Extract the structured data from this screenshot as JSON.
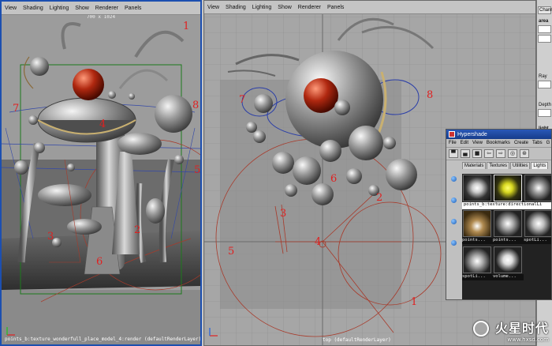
{
  "left_viewport": {
    "menu": [
      "View",
      "Shading",
      "Lighting",
      "Show",
      "Renderer",
      "Panels"
    ],
    "resolution": "700 x 1024",
    "caption": "points_b:texture_wonderfull_place_model_4:render (defaultRenderLayer)",
    "numbers": [
      "1",
      "2",
      "3",
      "4",
      "5",
      "6",
      "7",
      "8"
    ]
  },
  "right_viewport": {
    "menu": [
      "View",
      "Shading",
      "Lighting",
      "Show",
      "Renderer",
      "Panels"
    ],
    "caption": "top (defaultRenderLayer)",
    "numbers": [
      "1",
      "2",
      "3",
      "4",
      "5",
      "6",
      "7",
      "8"
    ]
  },
  "side_panel": {
    "tab": "Chann",
    "area_label": "area",
    "ray_label": "Ray",
    "depth_label": "Depth",
    "light_label": "light"
  },
  "hypershade": {
    "title": "Hypershade",
    "menu": [
      "File",
      "Edit",
      "View",
      "Bookmarks",
      "Create",
      "Tabs",
      "G"
    ],
    "tabs": [
      "Materials",
      "Textures",
      "Utilities",
      "Lights"
    ],
    "active_tab": "Lights",
    "swatch_header": "points_b:texture:directionalLi",
    "swatch_labels": [
      "points...",
      "points...",
      "spotLi...",
      "spotLi...",
      "volume..."
    ]
  },
  "watermark": {
    "text": "火星时代",
    "url": "www.hxsd.com"
  },
  "colors": {
    "active_border": "#1c4fb0",
    "annotation_red": "#e02020",
    "hypershade_title": "#2a58b8"
  }
}
